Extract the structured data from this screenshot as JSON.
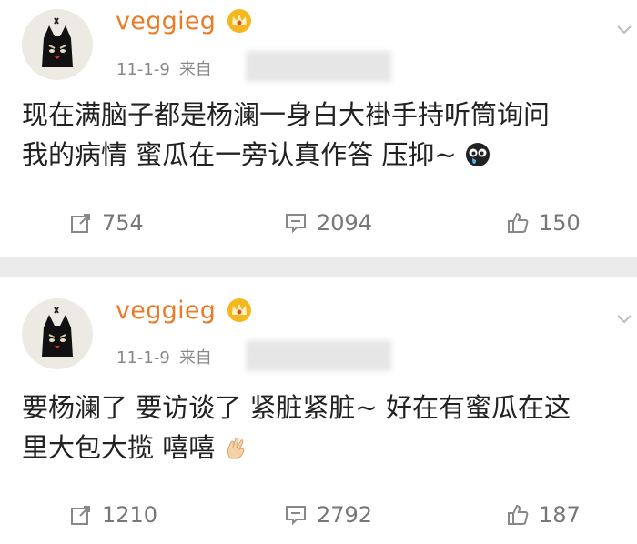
{
  "posts": [
    {
      "username": "veggieg",
      "date": "11-1-9",
      "source_prefix": "来自",
      "text_lines": [
        "现在满脑子都是杨澜一身白大褂手持听筒询问",
        "我的病情 蜜瓜在一旁认真作答 压抑~"
      ],
      "inline_icon": "crying-face-icon",
      "reposts": "754",
      "comments": "2094",
      "likes": "150"
    },
    {
      "username": "veggieg",
      "date": "11-1-9",
      "source_prefix": "来自",
      "text_lines": [
        "要杨澜了 要访谈了 紧脏紧脏~ 好在有蜜瓜在这",
        "里大包大揽 嘻嘻"
      ],
      "inline_icon": "ok-hand-icon",
      "reposts": "1210",
      "comments": "2792",
      "likes": "187"
    }
  ],
  "colors": {
    "username": "#eb7b27",
    "meta": "#888888",
    "text": "#222222",
    "separator": "#ebebeb",
    "action": "#777777"
  },
  "icons": [
    "cat-avatar-icon",
    "vip-crown-icon",
    "chevron-down-icon",
    "repost-icon",
    "comment-icon",
    "thumbs-up-icon"
  ]
}
